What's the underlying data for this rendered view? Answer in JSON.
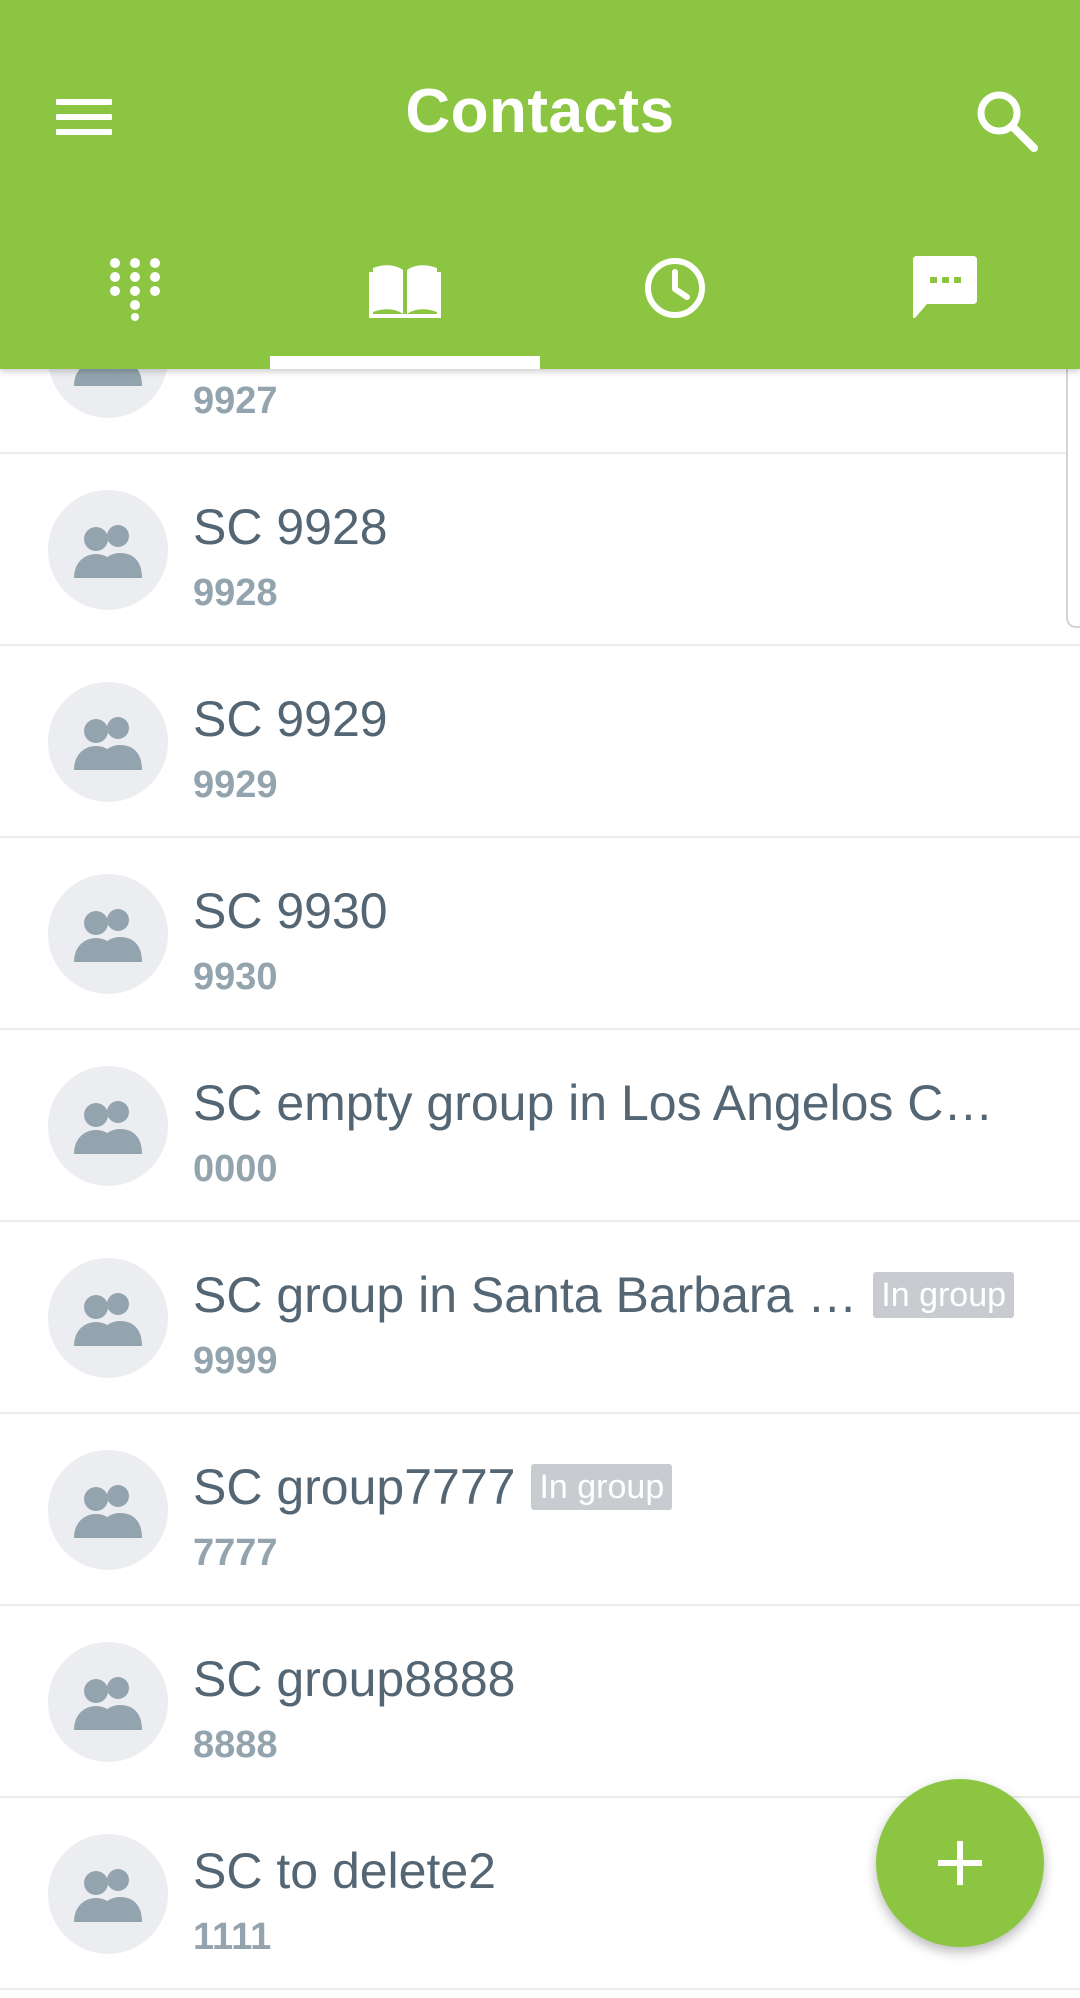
{
  "header": {
    "title": "Contacts",
    "menu_icon": "menu-icon",
    "search_icon": "search-icon",
    "color": "#8bc541"
  },
  "tabs": [
    {
      "icon": "dialpad-icon",
      "selected": false
    },
    {
      "icon": "contacts-book-icon",
      "selected": true
    },
    {
      "icon": "recents-clock-icon",
      "selected": false
    },
    {
      "icon": "messages-icon",
      "selected": false
    }
  ],
  "contacts": [
    {
      "name": "",
      "number": "9927",
      "badge": ""
    },
    {
      "name": "SC 9928",
      "number": "9928",
      "badge": ""
    },
    {
      "name": "SC 9929",
      "number": "9929",
      "badge": ""
    },
    {
      "name": "SC 9930",
      "number": "9930",
      "badge": ""
    },
    {
      "name": "SC empty group in Los Angelos C…",
      "number": "0000",
      "badge": ""
    },
    {
      "name": "SC group in Santa Barbara …",
      "number": "9999",
      "badge": "In group"
    },
    {
      "name": "SC group7777",
      "number": "7777",
      "badge": "In group"
    },
    {
      "name": "SC group8888",
      "number": "8888",
      "badge": ""
    },
    {
      "name": "SC to delete2",
      "number": "1111",
      "badge": ""
    }
  ],
  "fab": {
    "icon": "add-icon"
  }
}
